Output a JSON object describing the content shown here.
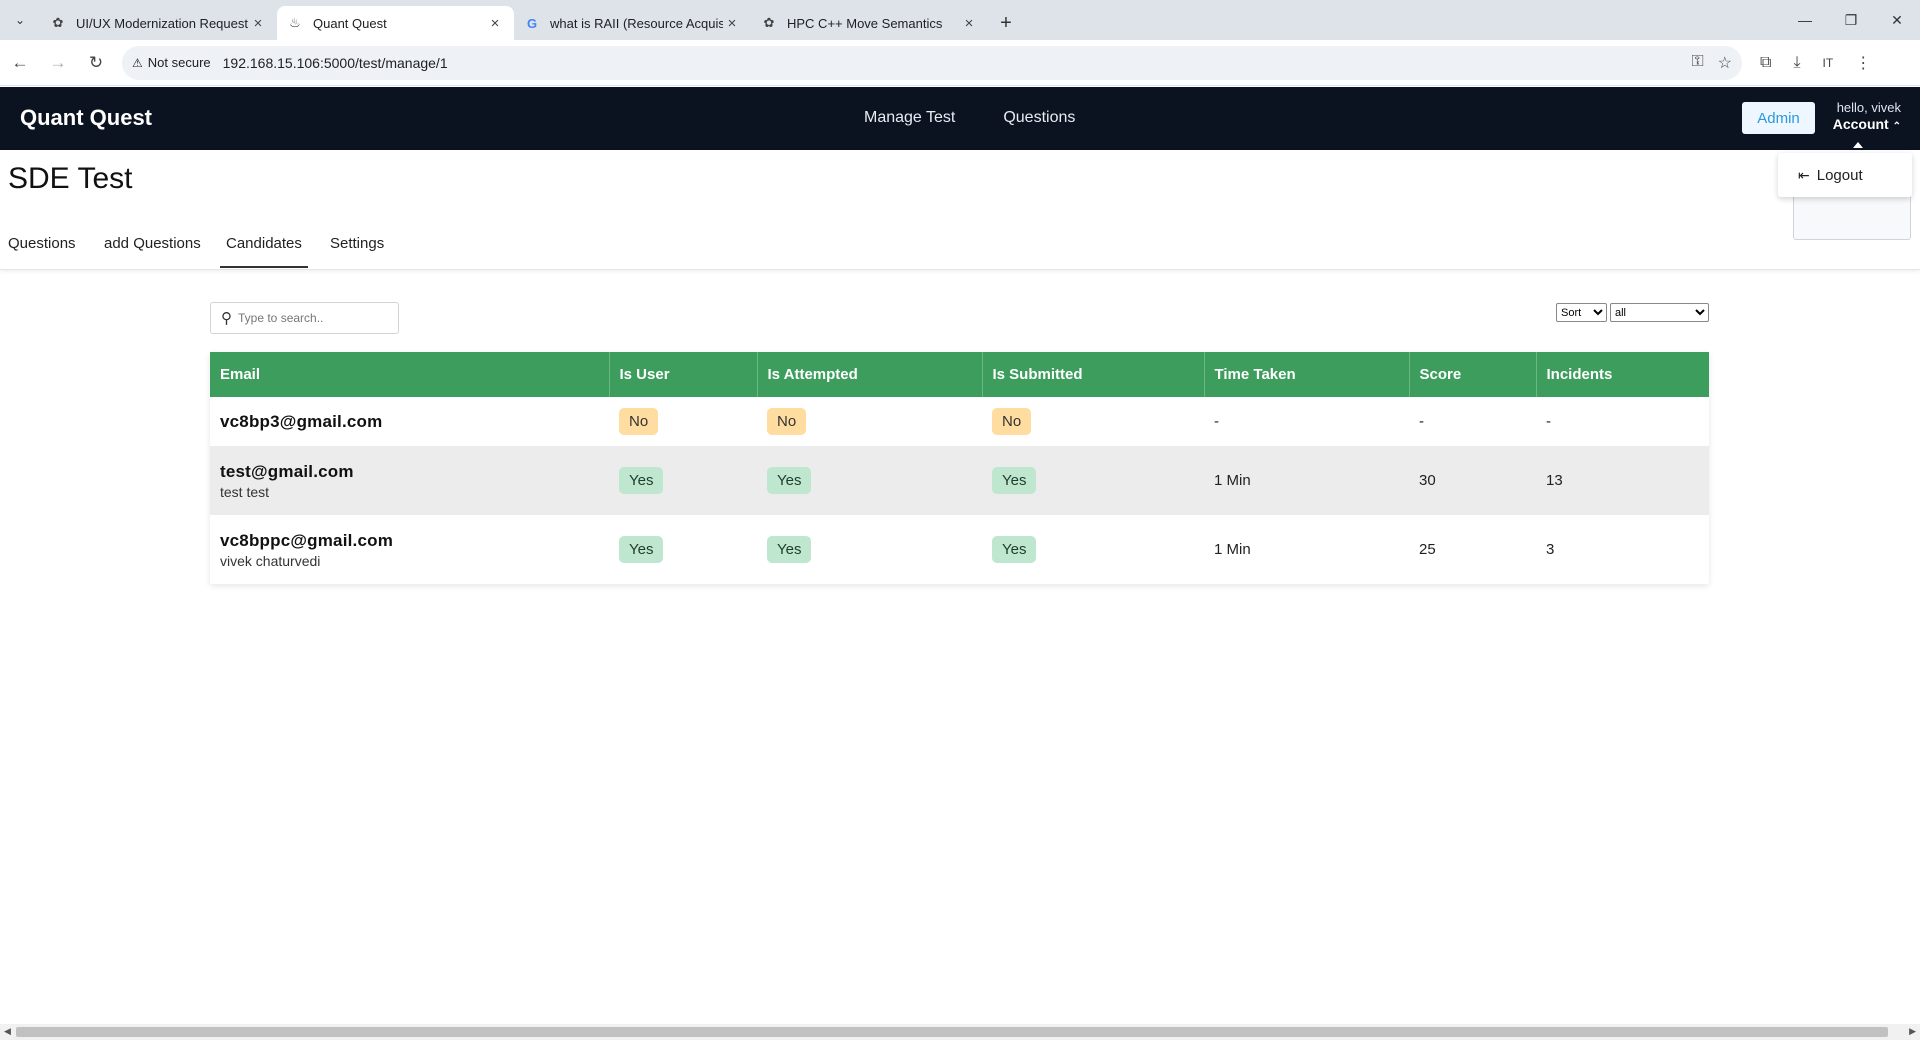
{
  "browser": {
    "tabs": [
      {
        "title": "UI/UX Modernization Request",
        "icon": "chatgpt-icon",
        "active": false
      },
      {
        "title": "Quant Quest",
        "icon": "page-icon",
        "active": true
      },
      {
        "title": "what is RAII (Resource Acquisiti",
        "icon": "google-icon",
        "active": false
      },
      {
        "title": "HPC C++ Move Semantics",
        "icon": "chatgpt-icon",
        "active": false
      }
    ],
    "security_label": "Not secure",
    "url": "192.168.15.106:5000/test/manage/1"
  },
  "app": {
    "brand": "Quant Quest",
    "nav": [
      "Manage Test",
      "Questions"
    ],
    "admin_label": "Admin",
    "hello": "hello, vivek",
    "account_label": "Account",
    "logout_label": "Logout"
  },
  "page": {
    "title": "SDE Test",
    "tabs": [
      "Questions",
      "add Questions",
      "Candidates",
      "Settings"
    ],
    "active_tab": "Candidates"
  },
  "search": {
    "placeholder": "Type to search.."
  },
  "sort": {
    "selected": "Sort",
    "filter_selected": "all"
  },
  "table": {
    "headers": [
      "Email",
      "Is User",
      "Is Attempted",
      "Is Submitted",
      "Time Taken",
      "Score",
      "Incidents"
    ],
    "rows": [
      {
        "email": "vc8bp3@gmail.com",
        "name": "",
        "is_user": "No",
        "is_attempted": "No",
        "is_submitted": "No",
        "time_taken": "-",
        "score": "-",
        "incidents": "-"
      },
      {
        "email": "test@gmail.com",
        "name": "test test",
        "is_user": "Yes",
        "is_attempted": "Yes",
        "is_submitted": "Yes",
        "time_taken": "1 Min",
        "score": "30",
        "incidents": "13"
      },
      {
        "email": "vc8bppc@gmail.com",
        "name": "vivek chaturvedi",
        "is_user": "Yes",
        "is_attempted": "Yes",
        "is_submitted": "Yes",
        "time_taken": "1 Min",
        "score": "25",
        "incidents": "3"
      }
    ]
  },
  "colors": {
    "header_bg": "#0b1320",
    "table_header": "#3c9d5d",
    "badge_yes": "#bfe6cf",
    "badge_no": "#ffdca0",
    "admin_text": "#2b9ad8"
  }
}
